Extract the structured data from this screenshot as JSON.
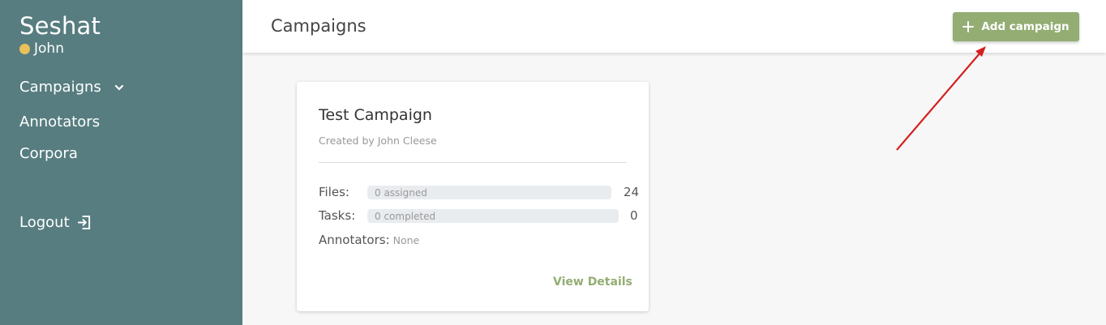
{
  "sidebar": {
    "brand": "Seshat",
    "user": "John",
    "nav": {
      "campaigns": "Campaigns",
      "annotators": "Annotators",
      "corpora": "Corpora",
      "logout": "Logout"
    }
  },
  "header": {
    "title": "Campaigns",
    "add_button": "Add campaign"
  },
  "card": {
    "title": "Test Campaign",
    "subtitle": "Created by John Cleese",
    "files_label": "Files:",
    "files_bar": "0 assigned",
    "files_count": "24",
    "tasks_label": "Tasks:",
    "tasks_bar": "0 completed",
    "tasks_count": "0",
    "annotators_label": "Annotators:",
    "annotators_value": "None",
    "files_progress": 0,
    "tasks_progress": 0,
    "view_details": "View Details"
  },
  "colors": {
    "sidebar_bg": "#577d80",
    "accent": "#93ad73",
    "user_dot": "#e8c15a",
    "annotation_arrow": "#d42020"
  },
  "icons": {
    "chevron": "chevron-down-icon",
    "logout": "logout-icon",
    "plus": "plus-icon"
  }
}
